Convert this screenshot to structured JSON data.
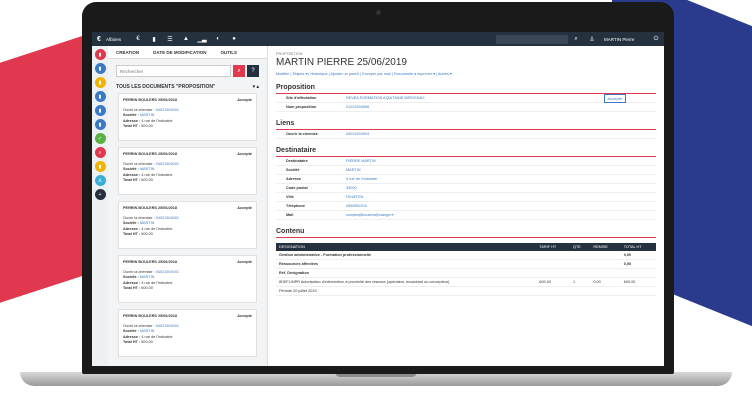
{
  "topbar": {
    "app_label": "Affaires",
    "user": "MARTIN Pierre",
    "logo": "€"
  },
  "list": {
    "tabs": [
      "CRÉATION",
      "DATE DE MODIFICATION",
      "OUTILS"
    ],
    "search_placeholder": "Rechercher",
    "section_title": "TOUS LES DOCUMENTS \"PROPOSITION\"",
    "cards": [
      {
        "title": "PERRIN BOULERS 25/06/2018",
        "status": "Accepté",
        "chemise": "04021904001",
        "societe": "MARTIN",
        "adresse": "4 rue de l'Industrie",
        "total": "600,00"
      },
      {
        "title": "PERRIN BOULERS 25/06/2018",
        "status": "Accepté",
        "chemise": "04021904001",
        "societe": "MARTIN",
        "adresse": "4 rue de l'Industrie",
        "total": "600,00"
      },
      {
        "title": "PERRIN BOULERS 25/06/2018",
        "status": "Accepté",
        "chemise": "04021904001",
        "societe": "MARTIN",
        "adresse": "4 rue de l'Industrie",
        "total": "600,00"
      },
      {
        "title": "PERRIN BOULERS 25/06/2018",
        "status": "Accepté",
        "chemise": "04021904001",
        "societe": "MARTIN",
        "adresse": "4 rue de l'Industrie",
        "total": "600,00"
      },
      {
        "title": "PERRIN BOULERS 25/06/2018",
        "status": "Accepté",
        "chemise": "04021904001",
        "societe": "MARTIN",
        "adresse": "4 rue de l'Industrie",
        "total": "600,00"
      }
    ],
    "labels": {
      "chemise": "Ouvrir la chemise :",
      "societe": "Société :",
      "adresse": "Adresse :",
      "total": "Total HT :"
    }
  },
  "doc": {
    "type": "PROPOSITION",
    "title": "MARTIN PIERRE 25/06/2019",
    "status": "Accepté",
    "actions": "Modifier | Étapes ▾ | Historique | Ajouter un post-it | Envoyer par mail | Documents à imprimer ▾ | Autres ▾",
    "proposition": {
      "heading": "Proposition",
      "rows": [
        {
          "k": "Site d'affectation",
          "v": "REVEA FORMATION AQUITAINE MERIGNAC"
        },
        {
          "k": "Num proposition",
          "v": "01021904696"
        }
      ]
    },
    "liens": {
      "heading": "Liens",
      "rows": [
        {
          "k": "Ouvrir la chemise",
          "v": "04021904004"
        }
      ]
    },
    "destinataire": {
      "heading": "Destinataire",
      "rows": [
        {
          "k": "Destinataire",
          "v": "PIERRE MARTIN"
        },
        {
          "k": "Société",
          "v": "MARTIN"
        },
        {
          "k": "Adresse",
          "v": "4 rue de l'Industrie"
        },
        {
          "k": "Code postal",
          "v": "33000"
        },
        {
          "k": "Ville",
          "v": "HOURTIN"
        },
        {
          "k": "Téléphone",
          "v": "0556552210"
        },
        {
          "k": "Mail",
          "v": "compta@boulers@orange.fr"
        }
      ]
    },
    "contenu": {
      "heading": "Contenu",
      "cols": [
        "DESIGNATION",
        "TARIF HT",
        "QTE",
        "REMISE",
        "TOTAL HT"
      ],
      "rows": [
        {
          "c": [
            "Gestion administrative - Formation professionnelle",
            "",
            "",
            "",
            "0,00"
          ],
          "sub": true
        },
        {
          "c": [
            "Ressources affectées",
            "",
            "",
            "",
            "0,00"
          ],
          "sub": true
        },
        {
          "c": [
            "Réf.   Désignation",
            "",
            "",
            "",
            ""
          ],
          "sub": true
        },
        {
          "c": [
            "8DEFLINPR   Autorisation d'intervention à proximité des réseaux (opérateur, encadrant ou concepteur)",
            "600,00",
            "1",
            "0,00",
            "600,00"
          ],
          "sub": false
        },
        {
          "c": [
            "Période   20 juillet 2019",
            "",
            "",
            "",
            ""
          ],
          "sub": false
        }
      ]
    }
  }
}
